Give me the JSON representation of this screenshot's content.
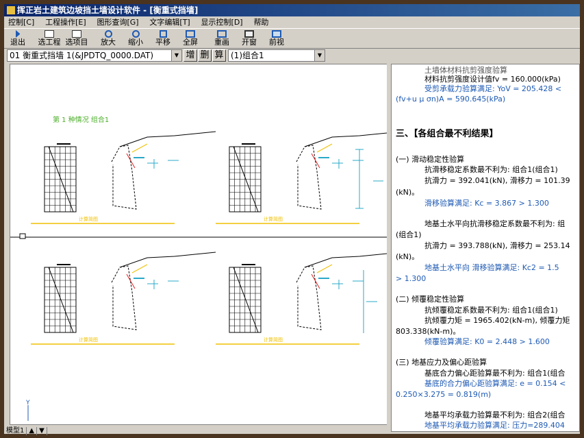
{
  "window": {
    "title": "挥正岩土建筑边坡挡土墙设计软件 - [衡重式挡墙]"
  },
  "menu": [
    "控制[C]",
    "工程操作[E]",
    "图形查询[G]",
    "文字编辑[T]",
    "显示控制[D]",
    "帮助"
  ],
  "toolbar": [
    {
      "label": "退出",
      "icon": "exit-icon"
    },
    {
      "label": "选工程",
      "icon": "select-project-icon"
    },
    {
      "label": "选项目",
      "icon": "select-item-icon"
    },
    {
      "label": "放大",
      "icon": "zoom-in-icon"
    },
    {
      "label": "缩小",
      "icon": "zoom-out-icon"
    },
    {
      "label": "平移",
      "icon": "pan-icon"
    },
    {
      "label": "全屏",
      "icon": "fullscreen-icon"
    },
    {
      "label": "重画",
      "icon": "redraw-icon"
    },
    {
      "label": "开窗",
      "icon": "window-icon"
    },
    {
      "label": "前视",
      "icon": "front-view-icon"
    }
  ],
  "file_combo": {
    "value": "01 衡重式挡墙 1(&JPDTQ_0000.DAT)"
  },
  "buttons": {
    "add": "增",
    "del": "删",
    "calc": "算"
  },
  "group_combo": {
    "value": "(1)组合1"
  },
  "drawing": {
    "caption1": "第 1 种情况  组合1",
    "footer_labels": [
      "计算简图",
      "计算简图",
      "计算简图",
      "计算简图"
    ]
  },
  "report": {
    "line_top1": "土墙体材料抗剪强度验算",
    "line_top2": "材料抗剪强度设计值fv = 160.000(kPa)",
    "line_top3": "受剪承载力验算满足: YoV = 205.428 <",
    "line_top4": "(fv+u μ σn)A = 590.645(kPa)",
    "section_title": "三、【各组合最不利结果】",
    "s1_title": "(一) 滑动稳定性验算",
    "s1_l1": "抗滑移稳定系数最不利为: 组合1(组合1)",
    "s1_l2": "抗滑力 = 392.041(kN), 滑移力 = 101.39",
    "s1_l3": "(kN)。",
    "s1_l4": "滑移验算满足: Kc = 3.867 > 1.300",
    "s1_l5": "地基土水平向抗滑移稳定系数最不利为: 组",
    "s1_l6": "(组合1)",
    "s1_l7": "抗滑力 = 393.788(kN), 滑移力 = 253.14",
    "s1_l8": "(kN)。",
    "s1_l9": "地基土水平向 滑移验算满足: Kc2 = 1.5",
    "s1_l10": "> 1.300",
    "s2_title": "(二) 倾覆稳定性验算",
    "s2_l1": "抗倾覆稳定系数最不利为: 组合1(组合1)",
    "s2_l2": "抗倾覆力矩 = 1965.402(kN-m), 倾覆力矩",
    "s2_l3": "803.338(kN-m)。",
    "s2_l4": "倾覆验算满足: K0 = 2.448 > 1.600",
    "s3_title": "(三) 地基应力及偏心距验算",
    "s3_l1": "基底合力偏心距验算最不利为: 组合1(组合",
    "s3_l2": "基底的合力偏心距验算满足: e = 0.154 <",
    "s3_l3": "0.250×3.275 = 0.819(m)",
    "s3_l4": "地基平均承载力验算最不利为: 组合2(组合",
    "s3_l5": "地基平均承载力验算满足: 压力=289.404"
  },
  "status": [
    "模型1",
    "▲",
    "▼"
  ]
}
